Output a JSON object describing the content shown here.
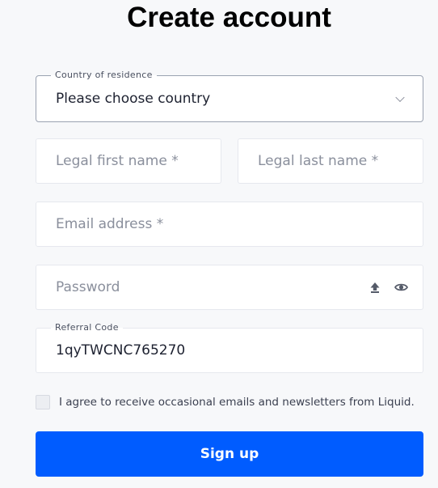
{
  "title": "Create account",
  "country": {
    "label": "Country of residence",
    "value": "Please choose country"
  },
  "first_name": {
    "placeholder": "Legal first name *"
  },
  "last_name": {
    "placeholder": "Legal last name *"
  },
  "email": {
    "placeholder": "Email address *"
  },
  "password": {
    "placeholder": "Password"
  },
  "referral": {
    "label": "Referral Code",
    "value": "1qyTWCNC765270"
  },
  "newsletter": {
    "label": "I agree to receive occasional emails and newsletters from Liquid.",
    "checked": false
  },
  "signup": {
    "label": "Sign up"
  },
  "colors": {
    "accent": "#005cff",
    "background": "#f7f8fa"
  },
  "icons": [
    "chevron-down-icon",
    "upload-icon",
    "eye-icon"
  ]
}
